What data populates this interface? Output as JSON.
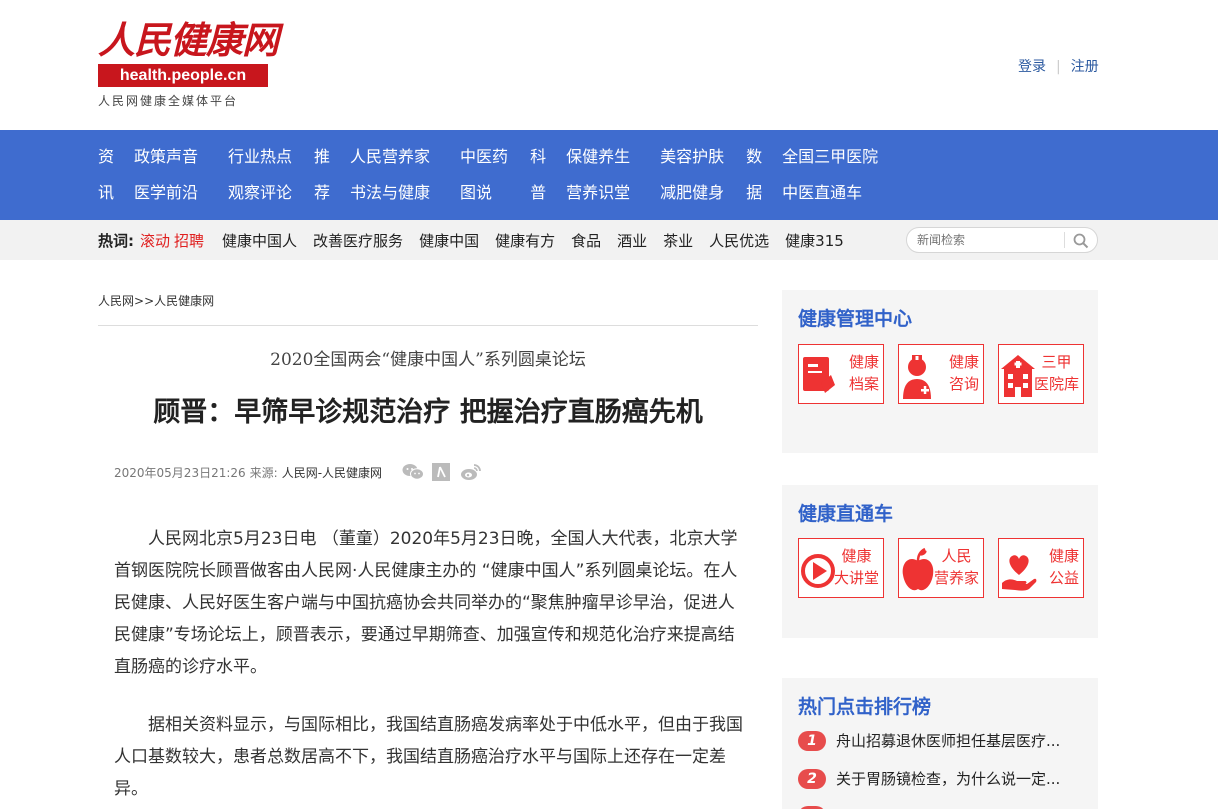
{
  "header": {
    "logo_title": "人民健康网",
    "logo_url": "health.people.cn",
    "logo_sub": "人民网健康全媒体平台",
    "login": "登录",
    "register": "注册"
  },
  "nav": {
    "groups": [
      {
        "cat": [
          "资",
          "讯"
        ],
        "cols": [
          [
            "政策声音",
            "医学前沿"
          ],
          [
            "行业热点",
            "观察评论"
          ]
        ]
      },
      {
        "cat": [
          "推",
          "荐"
        ],
        "cols": [
          [
            "人民营养家",
            "书法与健康"
          ],
          [
            "中医药",
            "图说"
          ]
        ]
      },
      {
        "cat": [
          "科",
          "普"
        ],
        "cols": [
          [
            "保健养生",
            "营养识堂"
          ],
          [
            "美容护肤",
            "减肥健身"
          ]
        ]
      },
      {
        "cat": [
          "数",
          "据"
        ],
        "cols": [
          [
            "全国三甲医院",
            "中医直通车"
          ]
        ]
      }
    ]
  },
  "hotbar": {
    "label": "热词:",
    "red1": "滚动",
    "red2": "招聘",
    "items": [
      "健康中国人",
      "改善医疗服务",
      "健康中国",
      "健康有方",
      "食品",
      "酒业",
      "茶业",
      "人民优选",
      "健康315"
    ],
    "search_placeholder": "新闻检索"
  },
  "article": {
    "crumb1": "人民网",
    "crumb_sep": ">>",
    "crumb2": "人民健康网",
    "subtitle": "2020全国两会“健康中国人”系列圆桌论坛",
    "title": "顾晋：早筛早诊规范治疗 把握治疗直肠癌先机",
    "date": "2020年05月23日21:26",
    "source_label": "来源:",
    "source": "人民网-人民健康网",
    "p1": "人民网北京5月23日电 （董童）2020年5月23日晚，全国人大代表，北京大学首钢医院院长顾晋做客由人民网·人民健康主办的 “健康中国人”系列圆桌论坛。在人民健康、人民好医生客户端与中国抗癌协会共同举办的“聚焦肿瘤早诊早治，促进人民健康”专场论坛上，顾晋表示，要通过早期筛查、加强宣传和规范化治疗来提高结直肠癌的诊疗水平。",
    "p2": "据相关资料显示，与国际相比，我国结直肠癌发病率处于中低水平，但由于我国人口基数较大，患者总数居高不下，我国结直肠癌治疗水平与国际上还存在一定差异。"
  },
  "sidebar": {
    "box1_title": "健康管理中心",
    "box1_tiles": [
      {
        "line1": "健康",
        "line2": "档案",
        "icon": "file-icon"
      },
      {
        "line1": "健康",
        "line2": "咨询",
        "icon": "doctor-icon"
      },
      {
        "line1": "三甲",
        "line2": "医院库",
        "icon": "hospital-icon"
      }
    ],
    "box2_title": "健康直通车",
    "box2_tiles": [
      {
        "line1": "健康",
        "line2": "大讲堂",
        "icon": "play-icon"
      },
      {
        "line1": "人民",
        "line2": "营养家",
        "icon": "apple-icon"
      },
      {
        "line1": "健康",
        "line2": "公益",
        "icon": "heart-hand-icon"
      }
    ],
    "box3_title": "热门点击排行榜",
    "rank": [
      {
        "num": "1",
        "text": "舟山招募退休医师担任基层医疗..."
      },
      {
        "num": "2",
        "text": "关于胃肠镜检查，为什么说一定..."
      }
    ]
  }
}
